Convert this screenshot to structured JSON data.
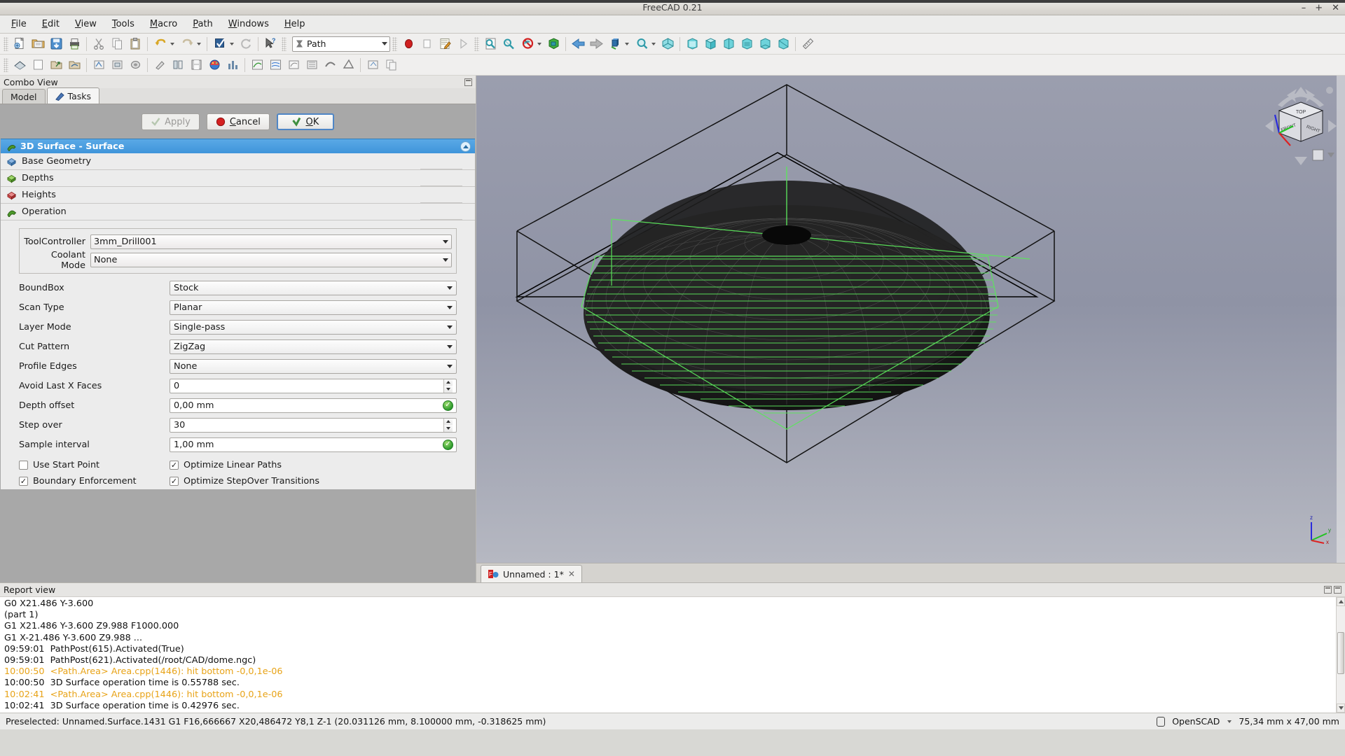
{
  "window": {
    "title": "FreeCAD 0.21",
    "minimize": "–",
    "maximize": "+",
    "close": "✕"
  },
  "menubar": {
    "items": [
      "File",
      "Edit",
      "View",
      "Tools",
      "Macro",
      "Path",
      "Windows",
      "Help"
    ]
  },
  "toolbar": {
    "workbench_selected": "Path",
    "icons_row1": [
      "new-document-icon",
      "open-folder-icon",
      "save-icon",
      "print-icon",
      "cut-icon",
      "copy-icon",
      "paste-icon",
      "undo-icon",
      "redo-icon",
      "refresh-icon",
      "whats-this-icon"
    ],
    "icons_row2": [
      "std-macro-record-icon",
      "std-macro-stop-icon",
      "std-macro-edit-icon",
      "std-macro-execute-icon",
      "fit-all-icon",
      "fit-selection-icon",
      "draw-style-icon",
      "axonometric-icon",
      "back-arrow-icon",
      "forward-arrow-icon",
      "std-view-icon",
      "zoom-box-icon",
      "isometric-icon",
      "front-view-icon",
      "top-view-icon",
      "right-view-icon",
      "rear-view-icon",
      "bottom-view-icon",
      "left-view-icon",
      "measure-icon"
    ]
  },
  "combo_view": {
    "panel_title": "Combo View",
    "tabs": [
      {
        "label": "Model",
        "active": false,
        "icon": ""
      },
      {
        "label": "Tasks",
        "active": true,
        "icon": "pencil-icon"
      }
    ]
  },
  "task_dialog": {
    "buttons": {
      "apply": "Apply",
      "cancel": "Cancel",
      "ok": "OK",
      "apply_enabled": false
    },
    "title": "3D Surface - Surface",
    "sections": [
      {
        "label": "Base Geometry",
        "icon": "base-geometry-icon"
      },
      {
        "label": "Depths",
        "icon": "depths-icon"
      },
      {
        "label": "Heights",
        "icon": "heights-icon"
      },
      {
        "label": "Operation",
        "icon": "operation-icon",
        "expanded": true
      }
    ],
    "operation": {
      "group_fields": [
        {
          "label": "ToolController",
          "value": "3mm_Drill001",
          "type": "combo"
        },
        {
          "label": "Coolant Mode",
          "value": "None",
          "type": "combo"
        }
      ],
      "fields": [
        {
          "label": "BoundBox",
          "value": "Stock",
          "type": "combo"
        },
        {
          "label": "Scan Type",
          "value": "Planar",
          "type": "combo"
        },
        {
          "label": "Layer Mode",
          "value": "Single-pass",
          "type": "combo"
        },
        {
          "label": "Cut Pattern",
          "value": "ZigZag",
          "type": "combo"
        },
        {
          "label": "Profile Edges",
          "value": "None",
          "type": "combo"
        },
        {
          "label": "Avoid Last X Faces",
          "value": "0",
          "type": "spin"
        },
        {
          "label": "Depth offset",
          "value": "0,00 mm",
          "type": "quantity"
        },
        {
          "label": "Step over",
          "value": "30",
          "type": "spin"
        },
        {
          "label": "Sample interval",
          "value": "1,00 mm",
          "type": "quantity"
        }
      ],
      "checkboxes": [
        {
          "label": "Use Start Point",
          "checked": false
        },
        {
          "label": "Optimize Linear Paths",
          "checked": true
        },
        {
          "label": "Boundary Enforcement",
          "checked": true
        },
        {
          "label": "Optimize StepOver Transitions",
          "checked": true
        }
      ]
    }
  },
  "view3d": {
    "document_tab": "Unnamed : 1*",
    "tab_close": "✕",
    "navcube": {
      "top_face": "TOP",
      "front_face": "FRONT",
      "right_face": "RIGHT"
    },
    "axis_labels": {
      "z": "z",
      "y": "y",
      "x": "x"
    }
  },
  "report_view": {
    "panel_title": "Report view",
    "lines": [
      {
        "text": "G0 X21.486 Y-3.600",
        "warn": false
      },
      {
        "text": "(part 1)",
        "warn": false
      },
      {
        "text": "G1 X21.486 Y-3.600 Z9.988 F1000.000",
        "warn": false
      },
      {
        "text": "G1 X-21.486 Y-3.600 Z9.988 ...",
        "warn": false
      },
      {
        "text": "09:59:01  PathPost(615).Activated(True)",
        "warn": false
      },
      {
        "text": "09:59:01  PathPost(621).Activated(/root/CAD/dome.ngc)",
        "warn": false
      },
      {
        "text": "10:00:50  <Path.Area> Area.cpp(1446): hit bottom -0,0,1e-06",
        "warn": true
      },
      {
        "text": "10:00:50  3D Surface operation time is 0.55788 sec.",
        "warn": false
      },
      {
        "text": "10:02:41  <Path.Area> Area.cpp(1446): hit bottom -0,0,1e-06",
        "warn": true
      },
      {
        "text": "10:02:41  3D Surface operation time is 0.42976 sec.",
        "warn": false
      }
    ]
  },
  "statusbar": {
    "preselected": "Preselected: Unnamed.Surface.1431 G1 F16,666667 X20,486472 Y8,1 Z-1 (20.031126 mm, 8.100000 mm, -0.318625 mm)",
    "unit_system": "OpenSCAD",
    "dimensions": "75,34 mm x 47,00 mm"
  },
  "colors": {
    "accent_blue": "#3f95da",
    "warn_orange": "#e8a317",
    "toolpath_green": "#55dd55",
    "window_bg": "#ececec"
  }
}
